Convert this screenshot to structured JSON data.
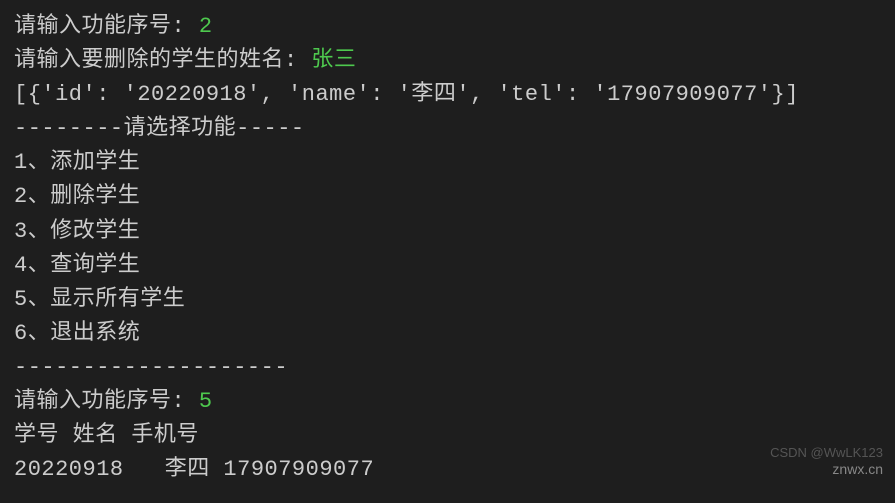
{
  "prompts": {
    "func_no": "请输入功能序号: ",
    "delete_name": "请输入要删除的学生的姓名: "
  },
  "inputs": {
    "func_no_1": "2",
    "delete_name_val": "张三",
    "func_no_2": "5"
  },
  "output": {
    "list_result": "[{'id': '20220918', 'name': '李四', 'tel': '17907909077'}]",
    "menu_header": "--------请选择功能-----",
    "menu_items": [
      "1、添加学生",
      "2、删除学生",
      "3、修改学生",
      "4、查询学生",
      "5、显示所有学生",
      "6、退出系统"
    ],
    "separator": "--------------------",
    "table_header": "学号 姓名 手机号",
    "table_row": "20220918   李四 17907909077"
  },
  "watermarks": {
    "wm1": "CSDN @WwLK123",
    "wm2": "znwx.cn"
  }
}
